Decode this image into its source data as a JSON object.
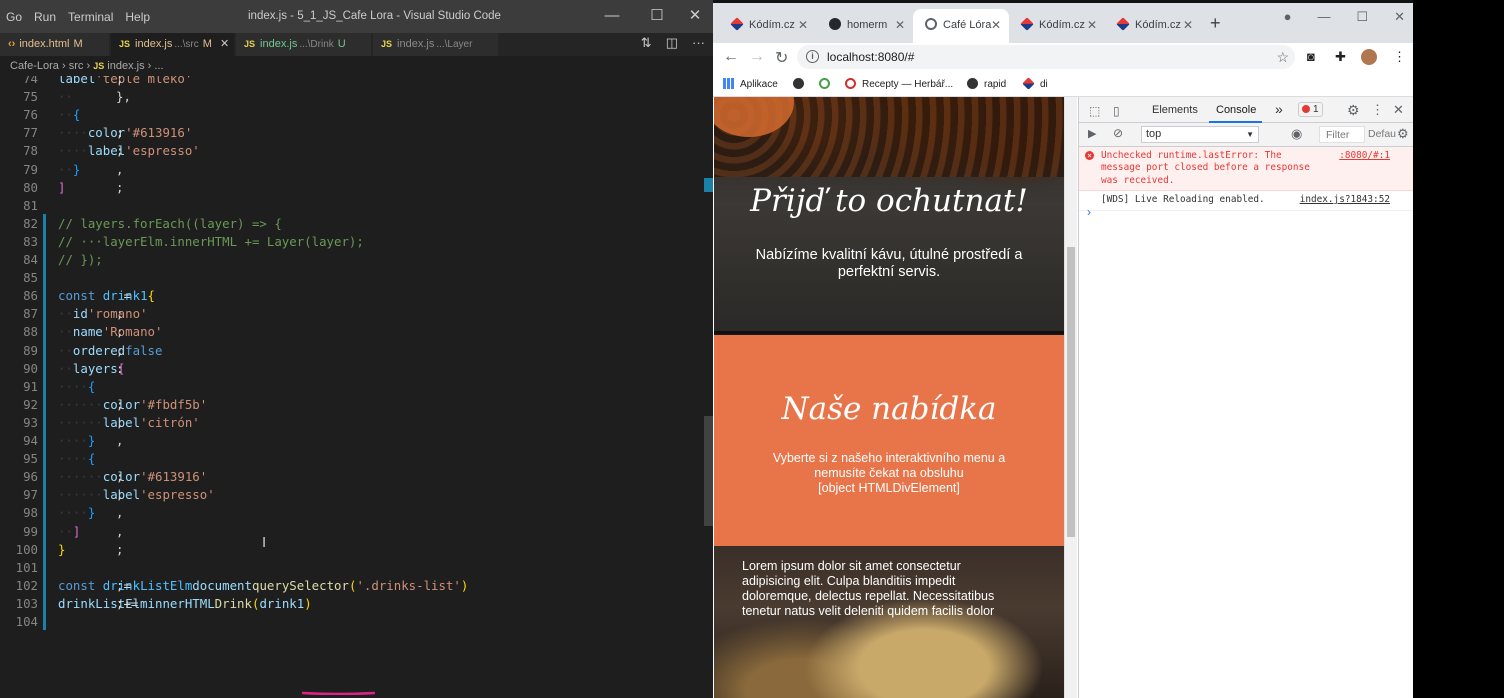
{
  "vscode": {
    "menu": [
      "Go",
      "Run",
      "Terminal",
      "Help"
    ],
    "window_title": "index.js - 5_1_JS_Cafe Lora - Visual Studio Code",
    "window_controls": [
      "—",
      "☐",
      "✕"
    ],
    "tabs": [
      {
        "label": "index.html",
        "path": "",
        "status": "M",
        "icon": "html-brace-icon"
      },
      {
        "label": "index.js",
        "path": "...\\src",
        "status": "M",
        "icon": "js-icon",
        "closable": "✕"
      },
      {
        "label": "index.js",
        "path": "...\\Drink",
        "status": "U",
        "icon": "js-icon"
      },
      {
        "label": "index.js",
        "path": "...\\Layer",
        "status": "",
        "icon": "js-icon"
      }
    ],
    "breadcrumb": {
      "project": "Cafe-Lora",
      "folder": "src",
      "file": "index.js",
      "symbol": "..."
    },
    "editor_lines": [
      {
        "n": "74",
        "tokens": [
          [
            "cd",
            "    "
          ],
          [
            "p",
            "label"
          ],
          [
            "cd",
            ": "
          ],
          [
            "s",
            "'teplé mléko'"
          ],
          [
            "cd",
            ","
          ]
        ]
      },
      {
        "n": "75",
        "tokens": [
          [
            "dot",
            "··"
          ],
          [
            "cd",
            "},"
          ]
        ]
      },
      {
        "n": "76",
        "tokens": [
          [
            "dot",
            "··"
          ],
          [
            "bk3",
            "{"
          ]
        ]
      },
      {
        "n": "77",
        "tokens": [
          [
            "dot",
            "····"
          ],
          [
            "p",
            "color"
          ],
          [
            "cd",
            ": "
          ],
          [
            "s",
            "'#613916'"
          ],
          [
            "cd",
            ","
          ]
        ]
      },
      {
        "n": "78",
        "tokens": [
          [
            "dot",
            "····"
          ],
          [
            "p",
            "label"
          ],
          [
            "cd",
            ": "
          ],
          [
            "s",
            "'espresso'"
          ],
          [
            "cd",
            ","
          ]
        ]
      },
      {
        "n": "79",
        "tokens": [
          [
            "dot",
            "··"
          ],
          [
            "bk3",
            "}"
          ],
          [
            "cd",
            ","
          ]
        ]
      },
      {
        "n": "80",
        "tokens": [
          [
            "bk2",
            "]"
          ],
          [
            "cd",
            ";"
          ]
        ]
      },
      {
        "n": "81",
        "tokens": []
      },
      {
        "n": "82",
        "tokens": [
          [
            "c",
            "// layers.forEach((layer) => {"
          ]
        ]
      },
      {
        "n": "83",
        "tokens": [
          [
            "c",
            "// ···layerElm.innerHTML += Layer(layer);"
          ]
        ]
      },
      {
        "n": "84",
        "tokens": [
          [
            "c",
            "// });"
          ]
        ]
      },
      {
        "n": "85",
        "tokens": []
      },
      {
        "n": "86",
        "tokens": [
          [
            "k",
            "const "
          ],
          [
            "v",
            "drink1"
          ],
          [
            "cd",
            " = "
          ],
          [
            "bk1",
            "{"
          ]
        ]
      },
      {
        "n": "87",
        "tokens": [
          [
            "dot",
            "··"
          ],
          [
            "p",
            "id"
          ],
          [
            "cd",
            ": "
          ],
          [
            "s",
            "'romano'"
          ],
          [
            "cd",
            ","
          ]
        ]
      },
      {
        "n": "88",
        "tokens": [
          [
            "dot",
            "··"
          ],
          [
            "p",
            "name"
          ],
          [
            "cd",
            ": "
          ],
          [
            "s",
            "'Romano'"
          ],
          [
            "cd",
            ","
          ]
        ]
      },
      {
        "n": "89",
        "tokens": [
          [
            "dot",
            "··"
          ],
          [
            "p",
            "ordered"
          ],
          [
            "cd",
            ": "
          ],
          [
            "k",
            "false"
          ],
          [
            "cd",
            ","
          ]
        ]
      },
      {
        "n": "90",
        "tokens": [
          [
            "dot",
            "··"
          ],
          [
            "p",
            "layers"
          ],
          [
            "cd",
            ": "
          ],
          [
            "bk2",
            "["
          ]
        ]
      },
      {
        "n": "91",
        "tokens": [
          [
            "dot",
            "····"
          ],
          [
            "bk3",
            "{"
          ]
        ]
      },
      {
        "n": "92",
        "tokens": [
          [
            "dot",
            "······"
          ],
          [
            "p",
            "color"
          ],
          [
            "cd",
            ": "
          ],
          [
            "s",
            "'#fbdf5b'"
          ],
          [
            "cd",
            ","
          ]
        ]
      },
      {
        "n": "93",
        "tokens": [
          [
            "dot",
            "······"
          ],
          [
            "p",
            "label"
          ],
          [
            "cd",
            ": "
          ],
          [
            "s",
            "'citrón'"
          ],
          [
            "cd",
            ","
          ]
        ]
      },
      {
        "n": "94",
        "tokens": [
          [
            "dot",
            "····"
          ],
          [
            "bk3",
            "}"
          ],
          [
            "cd",
            ","
          ]
        ]
      },
      {
        "n": "95",
        "tokens": [
          [
            "dot",
            "····"
          ],
          [
            "bk3",
            "{"
          ]
        ]
      },
      {
        "n": "96",
        "tokens": [
          [
            "dot",
            "······"
          ],
          [
            "p",
            "color"
          ],
          [
            "cd",
            ": "
          ],
          [
            "s",
            "'#613916'"
          ],
          [
            "cd",
            ","
          ]
        ]
      },
      {
        "n": "97",
        "tokens": [
          [
            "dot",
            "······"
          ],
          [
            "p",
            "label"
          ],
          [
            "cd",
            ": "
          ],
          [
            "s",
            "'espresso'"
          ],
          [
            "cd",
            ","
          ]
        ]
      },
      {
        "n": "98",
        "tokens": [
          [
            "dot",
            "····"
          ],
          [
            "bk3",
            "}"
          ],
          [
            "cd",
            ","
          ]
        ]
      },
      {
        "n": "99",
        "tokens": [
          [
            "dot",
            "··"
          ],
          [
            "bk2",
            "]"
          ],
          [
            "cd",
            ","
          ]
        ]
      },
      {
        "n": "100",
        "tokens": [
          [
            "bk1",
            "}"
          ],
          [
            "cd",
            ";"
          ]
        ]
      },
      {
        "n": "101",
        "tokens": []
      },
      {
        "n": "102",
        "tokens": [
          [
            "k",
            "const "
          ],
          [
            "v",
            "drinkListElm"
          ],
          [
            "cd",
            " = "
          ],
          [
            "p",
            "document"
          ],
          [
            "cd",
            "."
          ],
          [
            "f",
            "querySelector"
          ],
          [
            "bk1",
            "("
          ],
          [
            "s",
            "'.drinks-list'"
          ],
          [
            "bk1",
            ")"
          ],
          [
            "cd",
            ";"
          ]
        ]
      },
      {
        "n": "103",
        "tokens": [
          [
            "p",
            "drinkListElm"
          ],
          [
            "cd",
            "."
          ],
          [
            "p",
            "innerHTML"
          ],
          [
            "cd",
            " += "
          ],
          [
            "f",
            "Drink"
          ],
          [
            "bk1",
            "("
          ],
          [
            "p",
            "drink1"
          ],
          [
            "bk1",
            ")"
          ],
          [
            "cd",
            ";"
          ]
        ]
      },
      {
        "n": "104",
        "tokens": []
      }
    ],
    "annotation_color": "#e0218a"
  },
  "chrome": {
    "tabs": [
      {
        "label": "Kódím.cz",
        "icon": "kodim-icon"
      },
      {
        "label": "homerm",
        "icon": "github-icon"
      },
      {
        "label": "Café Lóra",
        "icon": "globe-icon",
        "active": true
      },
      {
        "label": "Kódím.cz",
        "icon": "kodim-icon"
      },
      {
        "label": "Kódím.cz",
        "icon": "kodim-icon"
      }
    ],
    "url": "localhost:8080/#",
    "bookmarks": [
      {
        "label": "Aplikace",
        "icon": "apps-icon"
      },
      {
        "label": "",
        "icon": "chromium-icon"
      },
      {
        "label": "",
        "icon": "github-icon"
      },
      {
        "label": "Recepty — Herbář...",
        "icon": "herbar-icon"
      },
      {
        "label": "rapid",
        "icon": "rapid-icon"
      },
      {
        "label": "di",
        "icon": "kodim-icon"
      }
    ]
  },
  "page": {
    "hero_title": "Přijď to ochutnat!",
    "hero_text": "Nabízíme kvalitní kávu, útulné prostředí a perfektní servis.",
    "offer_title": "Naše nabídka",
    "offer_text_1": "Vyberte si z našeho interaktivního menu a nemusíte čekat na obsluhu",
    "offer_text_2": "[object HTMLDivElement]",
    "cafe_text": "Lorem ipsum dolor sit amet consectetur adipisicing elit. Culpa blanditiis impedit doloremque, delectus repellat. Necessitatibus tenetur natus velit deleniti quidem facilis dolor"
  },
  "devtools": {
    "tabs": [
      "Elements",
      "Console"
    ],
    "active_tab": "Console",
    "more": "»",
    "error_count": "1",
    "context": "top",
    "filter_placeholder": "Filter",
    "levels": "Defau",
    "messages": [
      {
        "type": "error",
        "text": "Unchecked runtime.lastError: The message port closed before a response was received.",
        "source": ":8080/#:1"
      },
      {
        "type": "log",
        "text": "[WDS] Live Reloading enabled.",
        "source": "index.js?1843:52"
      }
    ],
    "prompt": "›"
  }
}
